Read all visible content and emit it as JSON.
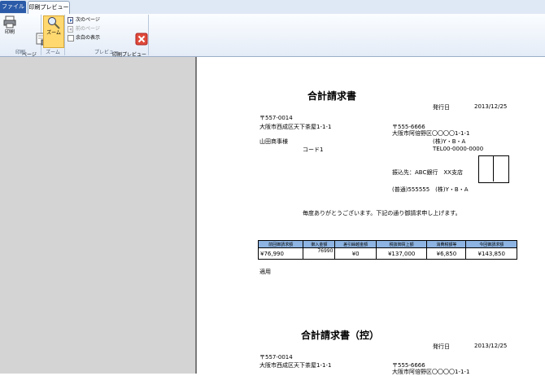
{
  "ribbon": {
    "tab_file": "ファイル",
    "tab_print_preview": "印刷プレビュー",
    "print_label": "印刷",
    "page_setup_label": "ページ\n設定",
    "zoom_label": "ズーム",
    "next_page_label": "次のページ",
    "prev_page_label": "前のページ",
    "show_margins_label": "余白の表示",
    "close_preview_label": "印刷プレビュー\nを閉じる",
    "group_print": "印刷",
    "group_zoom": "ズーム",
    "group_preview": "プレビュー"
  },
  "invoice": {
    "title": "合計請求書",
    "issue_date_label": "発行日",
    "issue_date": "2013/12/25",
    "to_postal": "〒557-0014",
    "to_address": "大阪市西成区天下茶屋1-1-1",
    "to_company": "山田商事様",
    "code_label": "コード1",
    "from_postal": "〒555-6666",
    "from_address": "大阪市阿倍野区〇〇〇〇1-1-1",
    "from_company": "(株)Y・B・A",
    "from_tel": "TEL00-0000-0000",
    "bank_label": "振込先：ABC銀行　XX支店",
    "account": "(普通)555555　(株)Y・B・A",
    "greeting": "毎度ありがとうございます。下記の通り御請求申し上げます。",
    "table_headers": [
      "前回御請求額",
      "御入金額",
      "差引繰越金額",
      "税抜御買上額",
      "消費税額等",
      "今回御請求額"
    ],
    "table_values": [
      "¥76,990",
      "76990",
      "¥0",
      "¥137,000",
      "¥6,850",
      "¥143,850"
    ],
    "notes_label": "適用"
  },
  "invoice_copy": {
    "title": "合計請求書（控）",
    "issue_date_label": "発行日",
    "issue_date": "2013/12/25",
    "to_postal": "〒557-0014",
    "to_address": "大阪市西成区天下茶屋1-1-1",
    "from_postal": "〒555-6666",
    "from_address": "大阪市阿倍野区〇〇〇〇1-1-1"
  },
  "colors": {
    "ribbon_blue": "#2a5aa8",
    "zoom_highlight": "#ffd870",
    "table_header": "#8db4e2"
  }
}
